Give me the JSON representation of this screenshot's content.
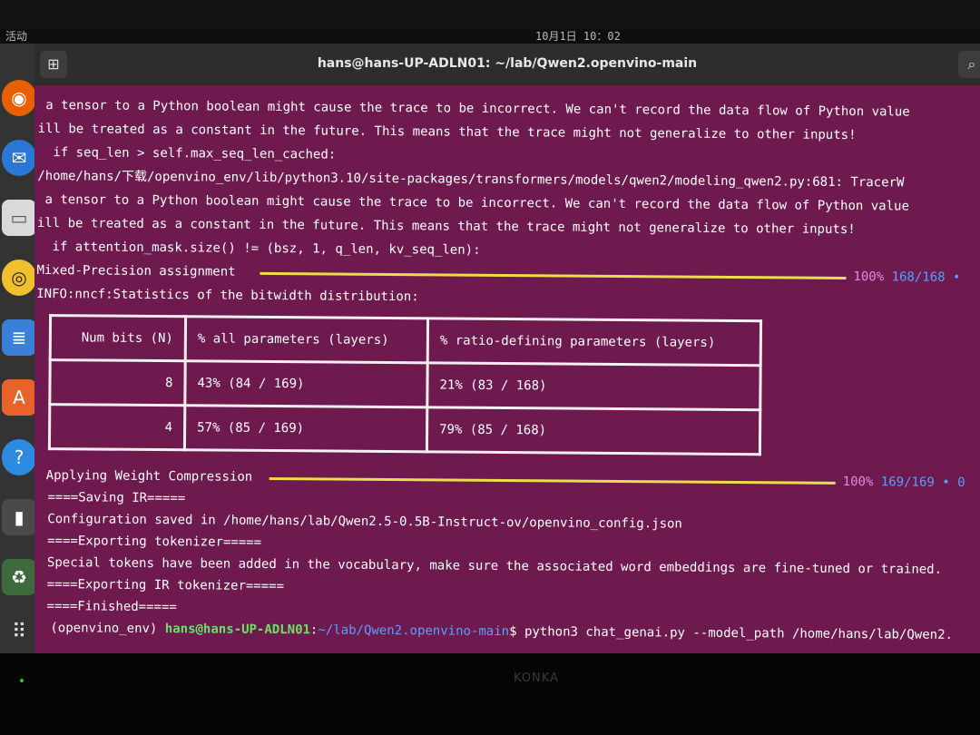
{
  "topbar": {
    "activities": "活动",
    "clock": "10月1日 10：02"
  },
  "window": {
    "title": "hans@hans-UP-ADLN01: ~/lab/Qwen2.openvino-main"
  },
  "dock": {
    "icons": [
      "firefox-icon",
      "thunderbird-icon",
      "files-icon",
      "rhythmbox-icon",
      "writer-icon",
      "software-icon",
      "help-icon",
      "terminal-icon",
      "trash-icon",
      "apps-grid-icon"
    ]
  },
  "terminal": {
    "lines": [
      " a tensor to a Python boolean might cause the trace to be incorrect. We can't record the data flow of Python value",
      "ill be treated as a constant in the future. This means that the trace might not generalize to other inputs!",
      "  if seq_len > self.max_seq_len_cached:",
      "/home/hans/下载/openvino_env/lib/python3.10/site-packages/transformers/models/qwen2/modeling_qwen2.py:681: TracerW",
      " a tensor to a Python boolean might cause the trace to be incorrect. We can't record the data flow of Python value",
      "ill be treated as a constant in the future. This means that the trace might not generalize to other inputs!",
      "  if attention_mask.size() != (bsz, 1, q_len, kv_seq_len):"
    ],
    "progress1": {
      "label": "Mixed-Precision assignment",
      "percent": "100%",
      "count": "168/168",
      "tail": "•",
      "fraction": 1.0
    },
    "info": "INFO:nncf:Statistics of the bitwidth distribution:",
    "table": {
      "headers": [
        "Num bits (N)",
        "% all parameters (layers)",
        "% ratio-defining parameters (layers)"
      ],
      "rows": [
        [
          "8",
          "43% (84 / 169)",
          "21% (83 / 168)"
        ],
        [
          "4",
          "57% (85 / 169)",
          "79% (85 / 168)"
        ]
      ]
    },
    "progress2": {
      "label": "Applying Weight Compression",
      "percent": "100%",
      "count": "169/169",
      "tail": "• 0",
      "fraction": 1.0
    },
    "after": [
      "====Saving IR=====",
      "Configuration saved in /home/hans/lab/Qwen2.5-0.5B-Instruct-ov/openvino_config.json",
      "====Exporting tokenizer=====",
      "Special tokens have been added in the vocabulary, make sure the associated word embeddings are fine-tuned or trained.",
      "====Exporting IR tokenizer=====",
      "====Finished====="
    ],
    "prompt": {
      "env": "(openvino_env) ",
      "user": "hans@hans-UP-ADLN01",
      "sep": ":",
      "path": "~/lab/Qwen2.openvino-main",
      "dollar": "$ ",
      "command": "python3 chat_genai.py --model_path /home/hans/lab/Qwen2."
    }
  },
  "monitor": {
    "brand": "KONKA"
  },
  "colors": {
    "terminal_bg": "#6e1a4e",
    "progress_bar": "#e8df4a",
    "percent": "#e08ae0",
    "count": "#4fa3ff"
  }
}
